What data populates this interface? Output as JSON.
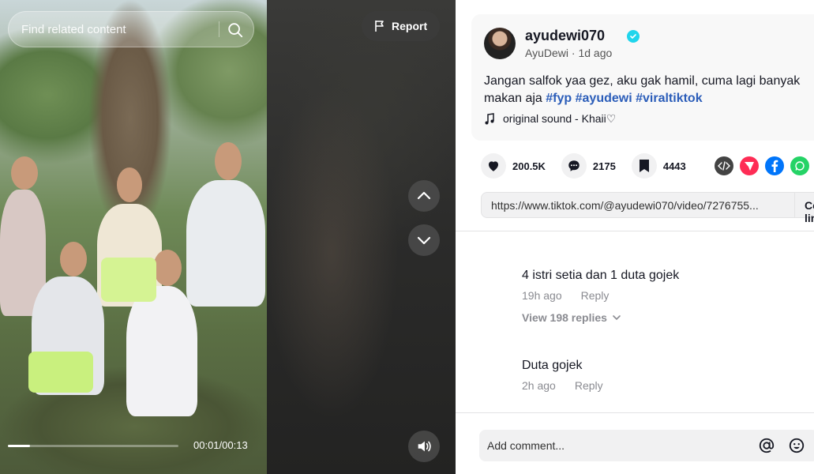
{
  "video": {
    "search_placeholder": "Find related content",
    "report_label": "Report",
    "time": "00:01/00:13",
    "progress_fraction": 0.13
  },
  "post": {
    "username": "ayudewi070",
    "display_name": "AyuDewi",
    "age": "1d ago",
    "caption_text": "Jangan salfok yaa gez, aku gak hamil, cuma lagi banyak makan aja ",
    "hashtags": [
      "#fyp",
      "#ayudewi",
      "#viraltiktok"
    ],
    "music": "original sound - Khaii♡"
  },
  "stats": {
    "likes": "200.5K",
    "comments": "2175",
    "saves": "4443"
  },
  "share": {
    "link": "https://www.tiktok.com/@ayudewi070/video/7276755...",
    "copy_label": "Copy link"
  },
  "comments": [
    {
      "text": "4 istri setia dan 1 duta gojek",
      "time": "19h ago",
      "reply": "Reply",
      "view_replies": "View 198 replies"
    },
    {
      "text": "Duta gojek",
      "time": "2h ago",
      "reply": "Reply"
    }
  ],
  "comment_bar": {
    "placeholder": "Add comment..."
  },
  "colors": {
    "hashtag": "#2b5db9",
    "verified": "#20d5ec",
    "embed": "#434343",
    "send_red": "#fe2c55",
    "facebook": "#0075fa",
    "whatsapp": "#25d366"
  },
  "icons": [
    "search-icon",
    "flag-icon",
    "chevron-up-icon",
    "chevron-down-icon",
    "volume-icon",
    "heart-icon",
    "comment-icon",
    "bookmark-icon",
    "embed-icon",
    "send-icon",
    "facebook-icon",
    "whatsapp-icon",
    "music-note-icon",
    "at-icon",
    "emoji-icon"
  ]
}
